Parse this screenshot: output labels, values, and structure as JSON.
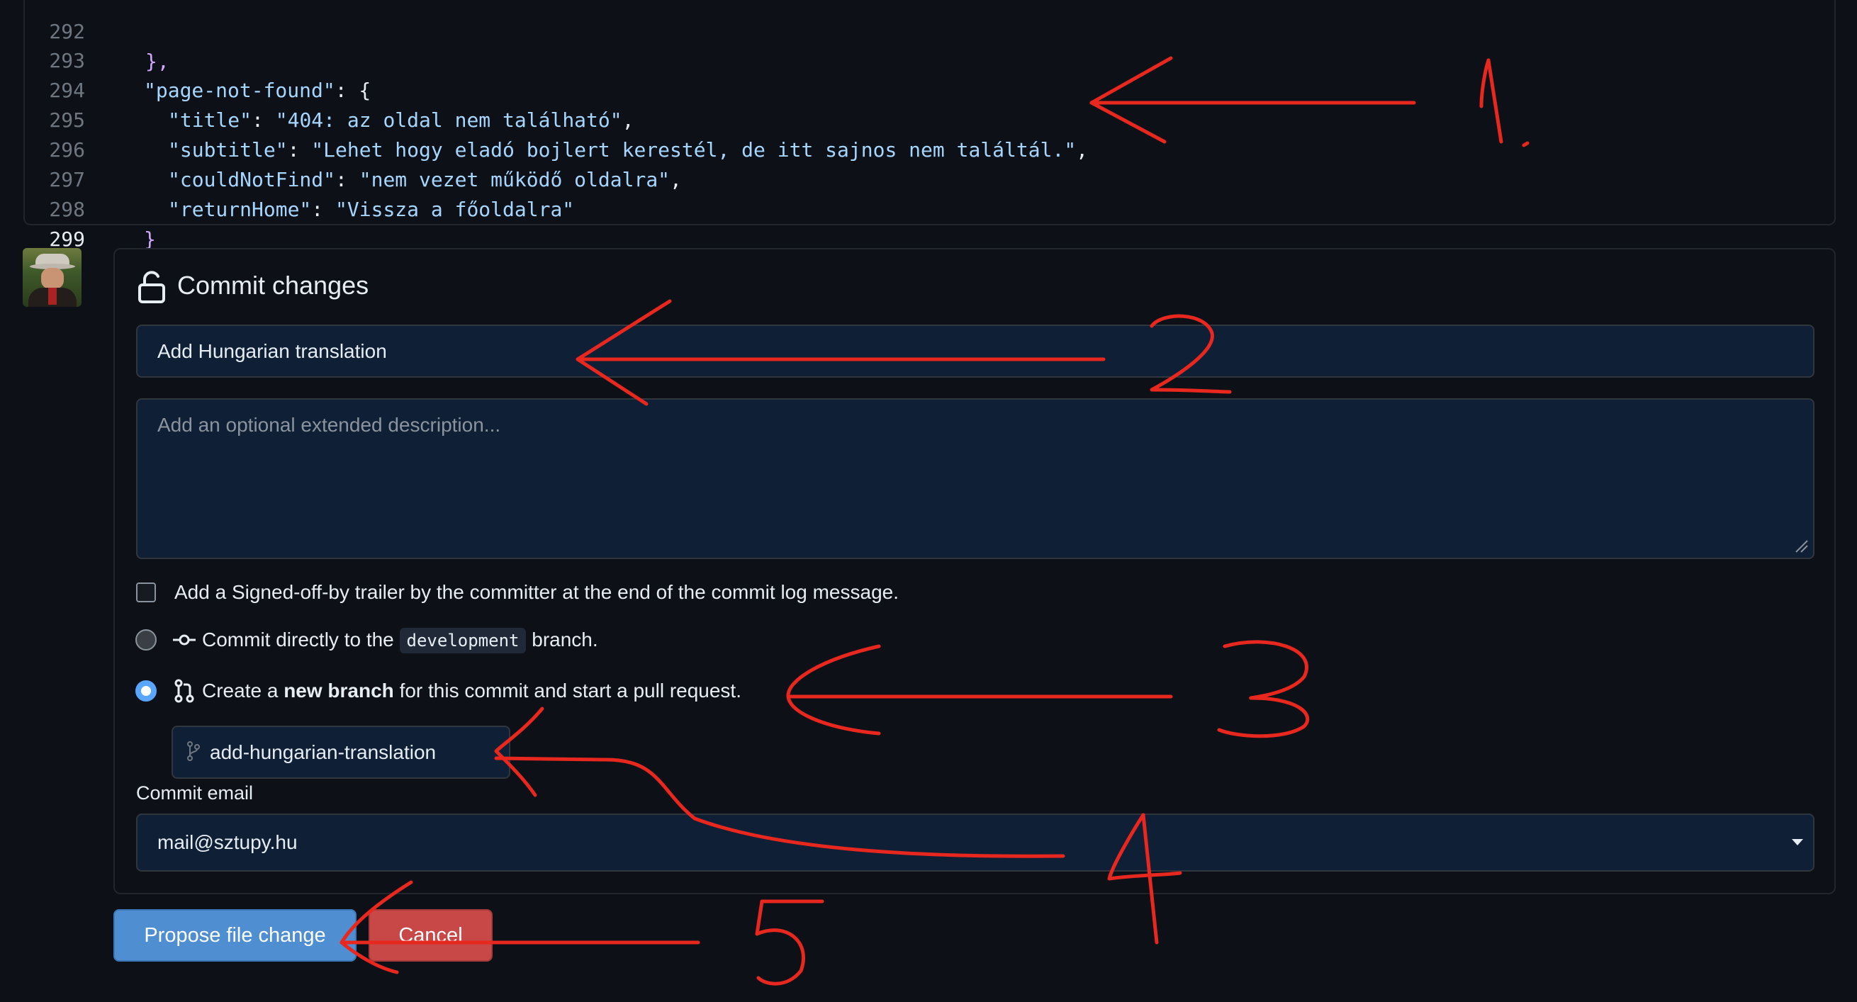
{
  "code": {
    "lines": [
      {
        "num": "292",
        "text": "},"
      },
      {
        "num": "293",
        "key": "\"page-not-found\"",
        "rest": ": {"
      },
      {
        "num": "294",
        "key": "\"title\"",
        "sep": ": ",
        "val": "\"404: az oldal nem található\"",
        "end": ","
      },
      {
        "num": "295",
        "key": "\"subtitle\"",
        "sep": ": ",
        "val": "\"Lehet hogy eladó bojlert kerestél, de itt sajnos nem találtál.\"",
        "end": ","
      },
      {
        "num": "296",
        "key": "\"couldNotFind\"",
        "sep": ": ",
        "val": "\"nem vezet működő oldalra\"",
        "end": ","
      },
      {
        "num": "297",
        "key": "\"returnHome\"",
        "sep": ": ",
        "val": "\"Vissza a főoldalra\"",
        "end": ""
      },
      {
        "num": "298",
        "text": "}"
      },
      {
        "num": "299",
        "text": "}"
      }
    ]
  },
  "commit": {
    "title": "Commit changes",
    "message_value": "Add Hungarian translation",
    "description_placeholder": "Add an optional extended description...",
    "signoff_label": "Add a Signed-off-by trailer by the committer at the end of the commit log message.",
    "direct_prefix": "Commit directly to the",
    "branch_name": "development",
    "direct_suffix": "branch.",
    "newbranch_prefix": "Create a",
    "newbranch_bold": "new branch",
    "newbranch_suffix": "for this commit and start a pull request.",
    "new_branch_value": "add-hungarian-translation",
    "email_label": "Commit email",
    "email_value": "mail@sztupy.hu",
    "propose_label": "Propose file change",
    "cancel_label": "Cancel",
    "selected_option": "new-branch"
  },
  "annotations": [
    "1.",
    "2",
    "3",
    "4",
    "5"
  ],
  "colors": {
    "background": "#0d1117",
    "primary_button": "#4f8fd1",
    "cancel_button": "#c84747",
    "annotation": "#e8271f",
    "radio_selected": "#58a6ff"
  }
}
